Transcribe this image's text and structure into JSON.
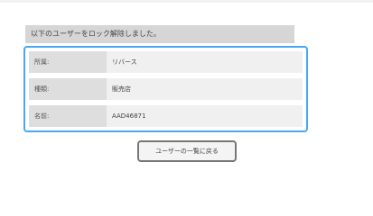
{
  "message": "以下のユーザーをロック解除しました。",
  "details": {
    "rows": [
      {
        "label": "所属:",
        "value": "リバース"
      },
      {
        "label": "種類:",
        "value": "販売店"
      },
      {
        "label": "名前:",
        "value": "AAD46871"
      }
    ]
  },
  "actions": {
    "back_label": "ユーザーの一覧に戻る"
  },
  "colors": {
    "panel_border": "#4aa8f0",
    "message_background": "#d6d6d6"
  }
}
